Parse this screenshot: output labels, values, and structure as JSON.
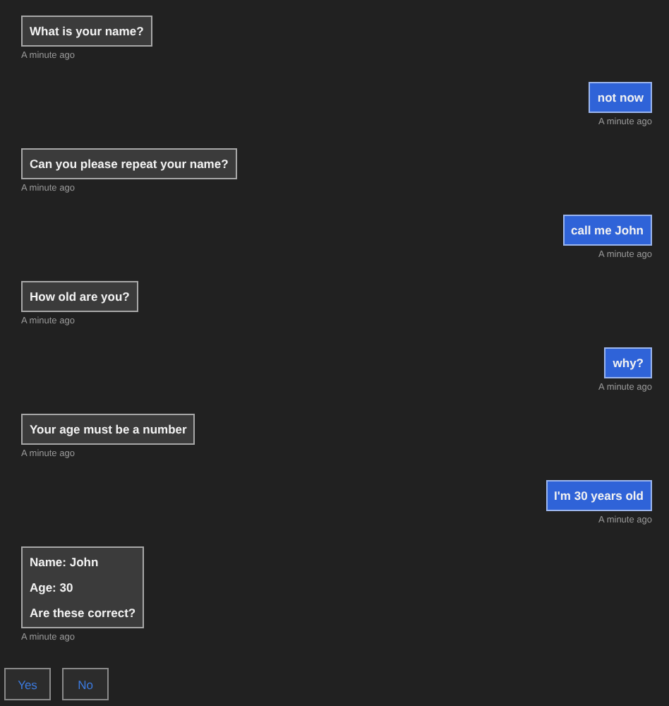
{
  "messages": [
    {
      "kind": "bot",
      "lines": [
        "What is your name?"
      ],
      "time": "A minute ago"
    },
    {
      "kind": "user",
      "lines": [
        "not now"
      ],
      "time": "A minute ago"
    },
    {
      "kind": "bot",
      "lines": [
        "Can you please repeat your name?"
      ],
      "time": "A minute ago"
    },
    {
      "kind": "user",
      "lines": [
        "call me John"
      ],
      "time": "A minute ago"
    },
    {
      "kind": "bot",
      "lines": [
        "How old are you?"
      ],
      "time": "A minute ago"
    },
    {
      "kind": "user",
      "lines": [
        "why?"
      ],
      "time": "A minute ago"
    },
    {
      "kind": "bot",
      "lines": [
        "Your age must be a number"
      ],
      "time": "A minute ago"
    },
    {
      "kind": "user",
      "lines": [
        "I'm 30 years old"
      ],
      "time": "A minute ago"
    },
    {
      "kind": "bot",
      "lines": [
        "Name: John",
        "Age: 30",
        "Are these correct?"
      ],
      "time": "A minute ago"
    }
  ],
  "buttons": [
    "Yes",
    "No"
  ]
}
